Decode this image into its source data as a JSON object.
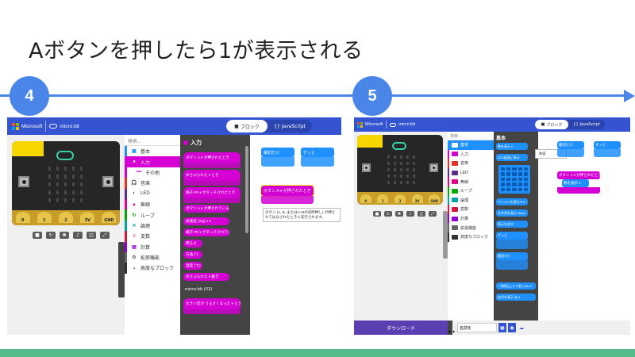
{
  "slide": {
    "title": "Aボタンを押したら1が表示される",
    "step_left": "4",
    "step_right": "5"
  },
  "left": {
    "brand_ms": "Microsoft",
    "brand_mb": "micro:bit",
    "tab_blocks": "ブロック",
    "tab_js": "JavaScript",
    "pin_labels": [
      "0",
      "1",
      "2",
      "3V",
      "GND"
    ],
    "search_placeholder": "検索...",
    "categories": [
      {
        "label": "基本",
        "icon": "grid-icon",
        "color": "#1e90ff"
      },
      {
        "label": "入力",
        "icon": "circle-icon",
        "color": "#d400d4",
        "selected": true
      },
      {
        "label": "その他",
        "icon": "dots-icon",
        "color": "#d400d4",
        "sub": true
      },
      {
        "label": "音楽",
        "icon": "headphones-icon",
        "color": "#e63022"
      },
      {
        "label": "LED",
        "icon": "toggle-icon",
        "color": "#5c2d91"
      },
      {
        "label": "無線",
        "icon": "antenna-icon",
        "color": "#e3008c"
      },
      {
        "label": "ループ",
        "icon": "loop-icon",
        "color": "#00aa00"
      },
      {
        "label": "論理",
        "icon": "shuffle-icon",
        "color": "#00a4a6"
      },
      {
        "label": "変数",
        "icon": "list-icon",
        "color": "#dc143c"
      },
      {
        "label": "計算",
        "icon": "calc-icon",
        "color": "#9400d3"
      },
      {
        "label": "拡張機能",
        "icon": "gear-icon",
        "color": "#666666"
      },
      {
        "label": "高度なブロック",
        "icon": "chevron-down-icon",
        "color": "#333333"
      }
    ],
    "flyout_title": "入力",
    "flyout_blocks": [
      "ボタン A ▾ が押されたとき",
      "ゆさぶられた ▾ とき",
      "端子 P0 ▾ がタッチされたとき",
      "ボタン A ▾ が押されている",
      "加速度 (mg) x ▾",
      "端子 P0 ▾ がタッチされている",
      "明るさ",
      "方角 (°)",
      "温度 (°C)",
      "ゆさぶられた ▾ 動き",
      "micro:bit (V2)",
      "大きい音が うるさくなった ▾ とき"
    ],
    "work_start": "最初だけ",
    "work_forever": "ずっと",
    "work_button": "ボタン A ▾ が押されたとき",
    "tooltip": "ボタン (A, B, またはA+Bの同時押し) が押されてはなされたときに実行されます。"
  },
  "right": {
    "brand_ms": "Microsoft",
    "brand_mb": "micro:bit",
    "tab_blocks": "ブロック",
    "tab_js": "JavaScript",
    "search_placeholder": "検索...",
    "categories": [
      {
        "label": "基本",
        "color": "#1e90ff",
        "selected": true
      },
      {
        "label": "入力",
        "color": "#d400d4"
      },
      {
        "label": "音楽",
        "color": "#e63022"
      },
      {
        "label": "LED",
        "color": "#5c2d91"
      },
      {
        "label": "無線",
        "color": "#e3008c"
      },
      {
        "label": "ループ",
        "color": "#00aa00"
      },
      {
        "label": "論理",
        "color": "#00a4a6"
      },
      {
        "label": "変数",
        "color": "#dc143c"
      },
      {
        "label": "計算",
        "color": "#9400d3"
      },
      {
        "label": "拡張機能",
        "color": "#666666"
      },
      {
        "label": "高度なブロック",
        "color": "#333333"
      }
    ],
    "flyout_title": "基本",
    "flyout_blocks": [
      "数を表示 0",
      "LED画面に表示",
      "アイコンを表示 ♥ ▾",
      "文字列を表示 Hello!",
      "表示を消す",
      "ずっと",
      "最初だけ",
      "一時停止 (ミリ秒) 100 ▾",
      "矢印を表示 北 ▾"
    ],
    "flyout_tooltip": "..数値",
    "work_start": "最初だけ",
    "work_forever": "ずっと",
    "work_button": "ボタン A ▾ が押されたとき",
    "work_show": "数を表示 1",
    "download": "ダウンロード",
    "more": "...",
    "filename": "名前を",
    "sim_pins": [
      "0",
      "1",
      "2",
      "3V",
      "GND"
    ]
  }
}
